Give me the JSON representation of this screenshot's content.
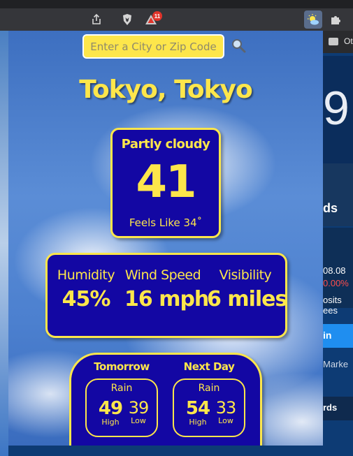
{
  "browser": {
    "rewards_badge": "11",
    "bookmark_label": "Ot"
  },
  "search": {
    "placeholder": "Enter a City or Zip Code"
  },
  "location": {
    "city": "Tokyo, Tokyo"
  },
  "current": {
    "condition": "Partly cloudy",
    "temperature": "41",
    "feels_like": "Feels Like 34˚"
  },
  "stats": [
    {
      "label": "Humidity",
      "value": "45%"
    },
    {
      "label": "Wind Speed",
      "value": "16 mph"
    },
    {
      "label": "Visibility",
      "value": "6 miles"
    }
  ],
  "forecast": [
    {
      "day": "Tomorrow",
      "condition": "Rain",
      "high": "49",
      "low": "39",
      "high_label": "High",
      "low_label": "Low"
    },
    {
      "day": "Next Day",
      "condition": "Rain",
      "high": "54",
      "low": "33",
      "high_label": "High",
      "low_label": "Low"
    }
  ],
  "background_page": {
    "big_number": "9",
    "section_label": "ds",
    "stock_value": "08.08",
    "stock_change": "0.00%",
    "deposits_line1": "osits",
    "deposits_line2": "ees",
    "join_label": "in",
    "markets_label": "Marke",
    "cards_label": "rds"
  }
}
